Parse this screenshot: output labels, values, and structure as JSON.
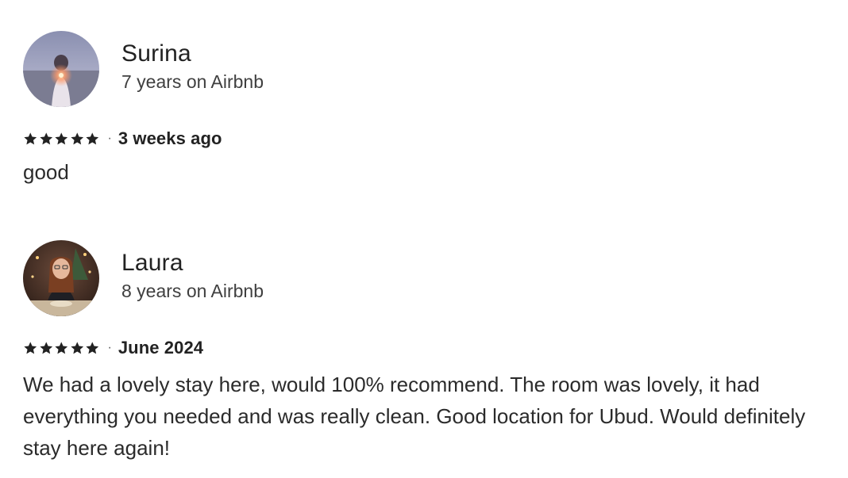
{
  "reviews": [
    {
      "name": "Surina",
      "tenure": "7 years on Airbnb",
      "rating": 5,
      "when": "3 weeks ago",
      "separator": "·",
      "text": "good",
      "avatar": "avatar-photo-surina"
    },
    {
      "name": "Laura",
      "tenure": "8 years on Airbnb",
      "rating": 5,
      "when": "June 2024",
      "separator": "·",
      "text": "We had a lovely stay here, would 100% recommend. The room was lovely, it had everything you needed and was really clean. Good location for Ubud. Would definitely stay here again!",
      "avatar": "avatar-photo-laura"
    }
  ],
  "colors": {
    "text": "#222222",
    "star": "#222222"
  },
  "icons": {
    "star": "star-icon"
  }
}
